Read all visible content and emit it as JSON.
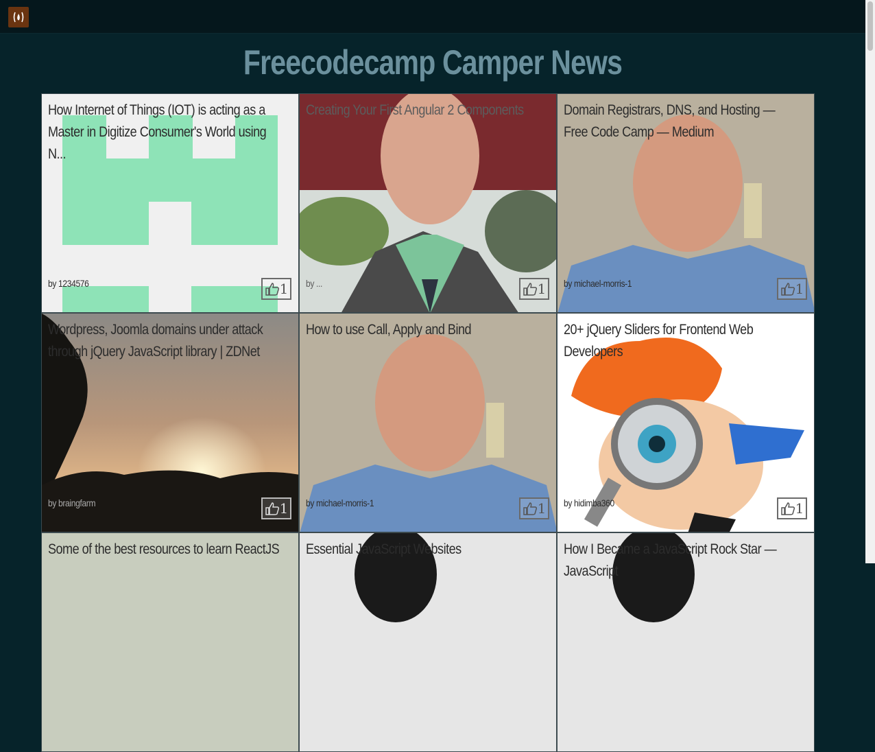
{
  "header": {
    "logo_text": "(🔥)",
    "logo_icon": "freecodecamp-flame-icon"
  },
  "page": {
    "title": "Freecodecamp Camper News"
  },
  "cards": [
    {
      "title": "How Internet of Things (IOT) is acting as a Master in Digitize Consumer's World using N...",
      "author": "by 1234576",
      "likes": "1",
      "image": "green-identicon"
    },
    {
      "title": "Creating Your First Angular 2 Components",
      "author": "by ...",
      "likes": "1",
      "image": "portrait-man-green-shirt"
    },
    {
      "title": "Domain Registrars, DNS, and Hosting — Free Code Camp — Medium",
      "author": "by michael-morris-1",
      "likes": "1",
      "image": "portrait-bald-man"
    },
    {
      "title": "Wordpress, Joomla domains under attack through jQuery JavaScript library | ZDNet",
      "author": "by braingfarm",
      "likes": "1",
      "image": "sunset-photo"
    },
    {
      "title": "How to use Call, Apply and Bind",
      "author": "by michael-morris-1",
      "likes": "1",
      "image": "portrait-bald-man"
    },
    {
      "title": "20+ jQuery Sliders for Frontend Web Developers",
      "author": "by hidimba360",
      "likes": "1",
      "image": "cartoon-magnifier-boy"
    },
    {
      "title": "Some of the best resources to learn ReactJS",
      "author": "",
      "likes": "",
      "image": "photo"
    },
    {
      "title": "Essential JavaScript Websites",
      "author": "",
      "likes": "",
      "image": "portrait-woman"
    },
    {
      "title": "How I Became a JavaScript Rock Star — JavaScript",
      "author": "",
      "likes": "",
      "image": "portrait-woman"
    }
  ],
  "colors": {
    "background": "#06232a",
    "title": "#6b909d",
    "topbar": "#05171c"
  }
}
